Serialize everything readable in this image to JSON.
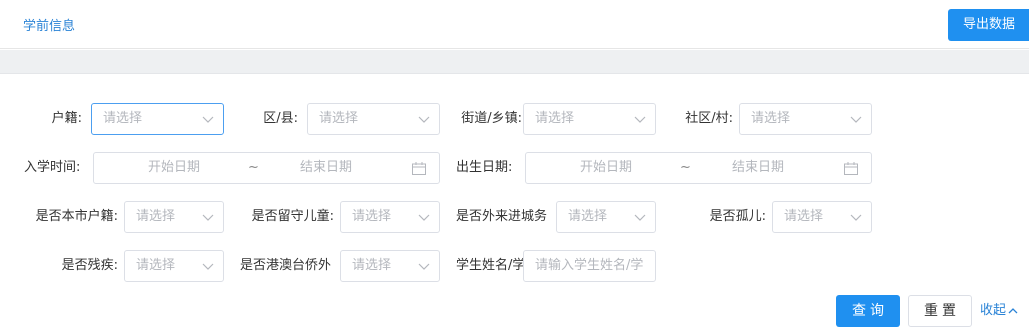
{
  "header": {
    "title": "学前信息",
    "export_label": "导出数据"
  },
  "filters": {
    "huji": {
      "label": "户籍:",
      "placeholder": "请选择"
    },
    "district": {
      "label": "区/县:",
      "placeholder": "请选择"
    },
    "street": {
      "label": "街道/乡镇:",
      "placeholder": "请选择"
    },
    "community": {
      "label": "社区/村:",
      "placeholder": "请选择"
    },
    "enroll_date": {
      "label": "入学时间:",
      "start_placeholder": "开始日期",
      "separator": "~",
      "end_placeholder": "结束日期"
    },
    "birth_date": {
      "label": "出生日期:",
      "start_placeholder": "开始日期",
      "separator": "~",
      "end_placeholder": "结束日期"
    },
    "local_huji": {
      "label": "是否本市户籍:",
      "placeholder": "请选择"
    },
    "left_behind": {
      "label": "是否留守儿童:",
      "placeholder": "请选择"
    },
    "migrant": {
      "label": "是否外来进城务",
      "placeholder": "请选择"
    },
    "orphan": {
      "label": "是否孤儿:",
      "placeholder": "请选择"
    },
    "disabled": {
      "label": "是否残疾:",
      "placeholder": "请选择"
    },
    "hk_macao_tw": {
      "label": "是否港澳台侨外",
      "placeholder": "请选择"
    },
    "student_name": {
      "label": "学生姓名/学",
      "placeholder": "请输入学生姓名/学"
    }
  },
  "actions": {
    "query_label": "查询",
    "reset_label": "重置",
    "collapse_label": "收起"
  },
  "colors": {
    "accent": "#1f90f0",
    "link": "#2a83d6",
    "border": "#dcdfe6",
    "placeholder": "#b4b7bd"
  }
}
